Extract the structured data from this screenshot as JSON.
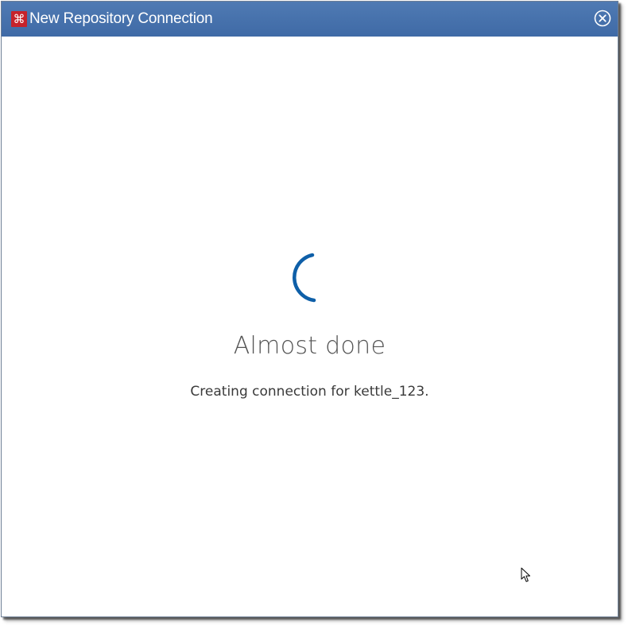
{
  "window": {
    "title": "New Repository Connection",
    "app_icon": "pentaho-spoon-icon",
    "close_icon": "close-circle-icon"
  },
  "status": {
    "heading": "Almost done",
    "message": "Creating connection for kettle_123.",
    "spinner_color": "#0e5fa8"
  },
  "colors": {
    "titlebar": "#4a74ad",
    "title_text": "#ffffff",
    "app_icon_bg": "#c6222b"
  }
}
